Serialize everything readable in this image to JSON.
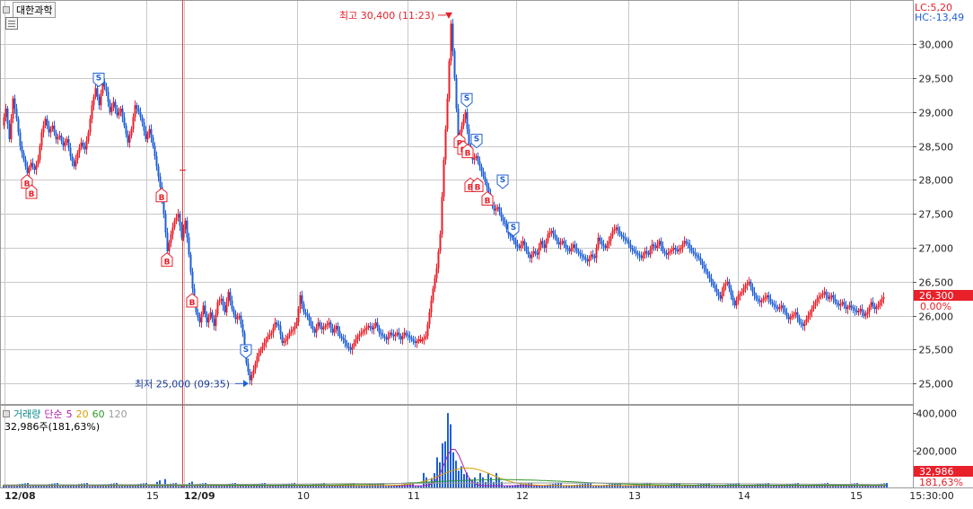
{
  "header": {
    "stock_name": "대한과학",
    "lc_label": "LC:5,20",
    "hc_label": "HC:-13,49"
  },
  "colors": {
    "up": "#e8202a",
    "down": "#1f5fd6",
    "ma5": "#b020b0",
    "ma20": "#d9a000",
    "ma60": "#2e9a2e",
    "ma120": "#9a9a9a",
    "grid": "#c8c8c8",
    "price_tag": "#e8202a"
  },
  "annotations": {
    "high_label": "최고 30,400 (11:23)",
    "low_label": "최저 25,000 (09:35)",
    "buy_marker": "B",
    "sell_marker": "S"
  },
  "price_panel": {
    "current_price": "26,300",
    "change_pct": "0.00%"
  },
  "volume_panel": {
    "volume_label": "거래량",
    "ma_label": "단순",
    "ma_periods": [
      "5",
      "20",
      "60",
      "120"
    ],
    "current_volume_text": "32,986주(181,63%)",
    "current_volume_tag": "32,986",
    "ratio_tag": "181,63%"
  },
  "chart_data": [
    {
      "type": "candlestick",
      "title": "",
      "y_ticks": [
        "25,000",
        "25,500",
        "26,000",
        "26,500",
        "27,000",
        "27,500",
        "28,000",
        "28,500",
        "29,000",
        "29,500",
        "30,000"
      ],
      "ylim": [
        24700,
        30650
      ],
      "x_ticks": [
        "12/08",
        "15",
        "12/09",
        "10",
        "11",
        "12",
        "13",
        "14",
        "15",
        "15:30:00"
      ],
      "grid": true,
      "high": 30400,
      "low": 25000,
      "last": 26300,
      "close_path": [
        [
          0,
          28800
        ],
        [
          4,
          29050
        ],
        [
          8,
          28600
        ],
        [
          12,
          29200
        ],
        [
          16,
          28900
        ],
        [
          20,
          28500
        ],
        [
          24,
          28300
        ],
        [
          28,
          28100
        ],
        [
          32,
          28250
        ],
        [
          36,
          28150
        ],
        [
          40,
          28300
        ],
        [
          44,
          28700
        ],
        [
          48,
          28900
        ],
        [
          52,
          28700
        ],
        [
          56,
          28800
        ],
        [
          60,
          28600
        ],
        [
          64,
          28650
        ],
        [
          68,
          28500
        ],
        [
          72,
          28600
        ],
        [
          76,
          28350
        ],
        [
          80,
          28200
        ],
        [
          84,
          28400
        ],
        [
          88,
          28550
        ],
        [
          92,
          28450
        ],
        [
          96,
          28700
        ],
        [
          100,
          29100
        ],
        [
          104,
          29350
        ],
        [
          108,
          29100
        ],
        [
          112,
          29450
        ],
        [
          116,
          29300
        ],
        [
          120,
          29000
        ],
        [
          124,
          29150
        ],
        [
          128,
          28950
        ],
        [
          132,
          29050
        ],
        [
          136,
          28800
        ],
        [
          140,
          28550
        ],
        [
          144,
          28750
        ],
        [
          148,
          29100
        ],
        [
          152,
          29000
        ],
        [
          156,
          28850
        ],
        [
          160,
          28600
        ],
        [
          164,
          28750
        ],
        [
          168,
          28500
        ],
        [
          172,
          28200
        ],
        [
          176,
          27900
        ],
        [
          180,
          27500
        ],
        [
          184,
          26950
        ],
        [
          188,
          27200
        ],
        [
          192,
          27400
        ],
        [
          196,
          27500
        ],
        [
          200,
          27150
        ],
        [
          204,
          27400
        ],
        [
          208,
          26900
        ],
        [
          212,
          26400
        ],
        [
          216,
          26050
        ],
        [
          220,
          25900
        ],
        [
          224,
          26150
        ],
        [
          228,
          25900
        ],
        [
          232,
          26050
        ],
        [
          236,
          25850
        ],
        [
          240,
          26200
        ],
        [
          244,
          26250
        ],
        [
          248,
          26050
        ],
        [
          252,
          26350
        ],
        [
          256,
          26100
        ],
        [
          260,
          25950
        ],
        [
          264,
          26000
        ],
        [
          268,
          25750
        ],
        [
          272,
          25300
        ],
        [
          276,
          25050
        ],
        [
          280,
          25200
        ],
        [
          284,
          25400
        ],
        [
          288,
          25500
        ],
        [
          292,
          25600
        ],
        [
          296,
          25700
        ],
        [
          300,
          25750
        ],
        [
          304,
          25900
        ],
        [
          308,
          25850
        ],
        [
          312,
          25600
        ],
        [
          316,
          25650
        ],
        [
          320,
          25750
        ],
        [
          324,
          25800
        ],
        [
          328,
          25900
        ],
        [
          332,
          26300
        ],
        [
          336,
          26050
        ],
        [
          340,
          26000
        ],
        [
          344,
          25850
        ],
        [
          348,
          25750
        ],
        [
          352,
          25900
        ],
        [
          356,
          25800
        ],
        [
          360,
          25850
        ],
        [
          364,
          25900
        ],
        [
          368,
          25750
        ],
        [
          372,
          25850
        ],
        [
          376,
          25700
        ],
        [
          380,
          25650
        ],
        [
          384,
          25550
        ],
        [
          388,
          25500
        ],
        [
          392,
          25600
        ],
        [
          396,
          25700
        ],
        [
          400,
          25750
        ],
        [
          404,
          25800
        ],
        [
          408,
          25850
        ],
        [
          412,
          25800
        ],
        [
          416,
          25900
        ],
        [
          420,
          25750
        ],
        [
          424,
          25700
        ],
        [
          428,
          25650
        ],
        [
          432,
          25750
        ],
        [
          436,
          25700
        ],
        [
          440,
          25750
        ],
        [
          444,
          25650
        ],
        [
          448,
          25750
        ],
        [
          452,
          25700
        ],
        [
          456,
          25650
        ],
        [
          460,
          25600
        ],
        [
          464,
          25650
        ],
        [
          468,
          25650
        ],
        [
          472,
          25700
        ],
        [
          476,
          26050
        ],
        [
          480,
          26400
        ],
        [
          484,
          26700
        ],
        [
          488,
          27200
        ],
        [
          492,
          28300
        ],
        [
          496,
          29200
        ],
        [
          500,
          30300
        ],
        [
          504,
          29500
        ],
        [
          508,
          28600
        ],
        [
          512,
          28800
        ],
        [
          516,
          29000
        ],
        [
          520,
          28500
        ],
        [
          524,
          28300
        ],
        [
          528,
          28350
        ],
        [
          532,
          28200
        ],
        [
          536,
          28050
        ],
        [
          540,
          27900
        ],
        [
          544,
          27700
        ],
        [
          548,
          27550
        ],
        [
          552,
          27600
        ],
        [
          556,
          27450
        ],
        [
          560,
          27350
        ],
        [
          564,
          27200
        ],
        [
          568,
          27150
        ],
        [
          572,
          27050
        ],
        [
          576,
          27000
        ],
        [
          580,
          27100
        ],
        [
          584,
          26950
        ],
        [
          588,
          26850
        ],
        [
          592,
          26950
        ],
        [
          596,
          26900
        ],
        [
          600,
          27100
        ],
        [
          604,
          27000
        ],
        [
          608,
          27200
        ],
        [
          612,
          27250
        ],
        [
          616,
          27150
        ],
        [
          620,
          27050
        ],
        [
          624,
          27100
        ],
        [
          628,
          27000
        ],
        [
          632,
          26950
        ],
        [
          636,
          27050
        ],
        [
          640,
          26950
        ],
        [
          644,
          26900
        ],
        [
          648,
          26850
        ],
        [
          652,
          26800
        ],
        [
          656,
          26900
        ],
        [
          660,
          26850
        ],
        [
          664,
          27150
        ],
        [
          668,
          27050
        ],
        [
          672,
          27000
        ],
        [
          676,
          27100
        ],
        [
          680,
          27250
        ],
        [
          684,
          27300
        ],
        [
          688,
          27200
        ],
        [
          692,
          27150
        ],
        [
          696,
          27100
        ],
        [
          700,
          27000
        ],
        [
          704,
          26950
        ],
        [
          708,
          26900
        ],
        [
          712,
          26850
        ],
        [
          716,
          26950
        ],
        [
          720,
          26900
        ],
        [
          724,
          27050
        ],
        [
          728,
          27000
        ],
        [
          732,
          27100
        ],
        [
          736,
          26950
        ],
        [
          740,
          26900
        ],
        [
          744,
          26950
        ],
        [
          748,
          27000
        ],
        [
          752,
          26950
        ],
        [
          756,
          27000
        ],
        [
          760,
          27100
        ],
        [
          764,
          27050
        ],
        [
          768,
          26950
        ],
        [
          772,
          26900
        ],
        [
          776,
          26850
        ],
        [
          780,
          26750
        ],
        [
          784,
          26650
        ],
        [
          788,
          26550
        ],
        [
          792,
          26450
        ],
        [
          796,
          26350
        ],
        [
          800,
          26250
        ],
        [
          804,
          26450
        ],
        [
          808,
          26500
        ],
        [
          812,
          26300
        ],
        [
          816,
          26150
        ],
        [
          820,
          26300
        ],
        [
          824,
          26350
        ],
        [
          828,
          26450
        ],
        [
          832,
          26500
        ],
        [
          836,
          26350
        ],
        [
          840,
          26250
        ],
        [
          844,
          26200
        ],
        [
          848,
          26250
        ],
        [
          852,
          26300
        ],
        [
          856,
          26200
        ],
        [
          860,
          26150
        ],
        [
          864,
          26100
        ],
        [
          868,
          26150
        ],
        [
          872,
          26050
        ],
        [
          876,
          25950
        ],
        [
          880,
          26000
        ],
        [
          884,
          26050
        ],
        [
          888,
          25900
        ],
        [
          892,
          25850
        ],
        [
          896,
          25950
        ],
        [
          900,
          26050
        ],
        [
          904,
          26150
        ],
        [
          908,
          26250
        ],
        [
          912,
          26300
        ],
        [
          916,
          26350
        ],
        [
          920,
          26250
        ],
        [
          924,
          26300
        ],
        [
          928,
          26200
        ],
        [
          932,
          26150
        ],
        [
          936,
          26200
        ],
        [
          940,
          26100
        ],
        [
          944,
          26150
        ],
        [
          948,
          26100
        ],
        [
          952,
          26050
        ],
        [
          956,
          26100
        ],
        [
          960,
          26000
        ],
        [
          964,
          26050
        ],
        [
          968,
          26200
        ],
        [
          972,
          26100
        ],
        [
          976,
          26150
        ],
        [
          980,
          26250
        ],
        [
          984,
          26300
        ]
      ]
    },
    {
      "type": "bar",
      "title": "",
      "y_ticks": [
        "200,000",
        "400,000"
      ],
      "ylim": [
        0,
        420000
      ],
      "peak_volume": 400000,
      "last_volume": 32986
    }
  ]
}
